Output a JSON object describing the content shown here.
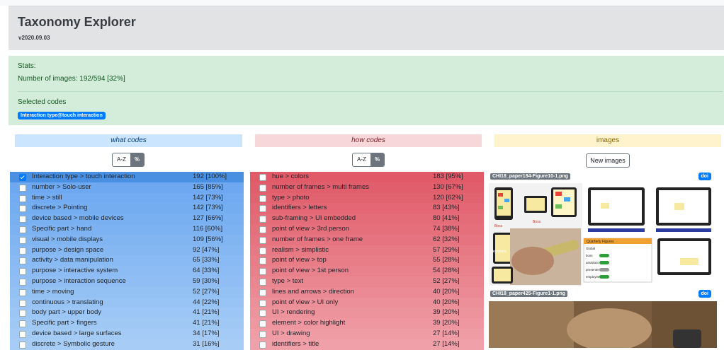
{
  "header": {
    "title": "Taxonomy Explorer",
    "version": "v2020.09.03"
  },
  "stats": {
    "heading": "Stats:",
    "images_line": "Number of images: 192/594 [32%]",
    "selected_heading": "Selected codes",
    "selected_badge": "Interaction type@touch interaction"
  },
  "what": {
    "heading": "what",
    "heading_suffix": " codes",
    "sort_az": "A-Z",
    "sort_pct": "%",
    "items": [
      {
        "label": "Interaction type > touch interaction",
        "count": "192 [100%]",
        "checked": true
      },
      {
        "label": "number > Solo-user",
        "count": "165 [85%]"
      },
      {
        "label": "time > still",
        "count": "142 [73%]"
      },
      {
        "label": "discrete > Pointing",
        "count": "142 [73%]"
      },
      {
        "label": "device based > mobile devices",
        "count": "127 [66%]"
      },
      {
        "label": "Specific part > hand",
        "count": "116 [60%]"
      },
      {
        "label": "visual > mobile displays",
        "count": "109 [56%]"
      },
      {
        "label": "purpose > design space",
        "count": "92 [47%]"
      },
      {
        "label": "activity > data manipulation",
        "count": "65 [33%]"
      },
      {
        "label": "purpose > interactive system",
        "count": "64 [33%]"
      },
      {
        "label": "purpose > interaction sequence",
        "count": "59 [30%]"
      },
      {
        "label": "time > moving",
        "count": "52 [27%]"
      },
      {
        "label": "continuous > translating",
        "count": "44 [22%]"
      },
      {
        "label": "body part > upper body",
        "count": "41 [21%]"
      },
      {
        "label": "Specific part > fingers",
        "count": "41 [21%]"
      },
      {
        "label": "device based > large surfaces",
        "count": "34 [17%]"
      },
      {
        "label": "discrete > Symbolic gesture",
        "count": "31 [16%]"
      }
    ]
  },
  "how": {
    "heading": "how",
    "heading_suffix": " codes",
    "sort_az": "A-Z",
    "sort_pct": "%",
    "items": [
      {
        "label": "hue > colors",
        "count": "183 [95%]"
      },
      {
        "label": "number of frames > multi frames",
        "count": "130 [67%]"
      },
      {
        "label": "type > photo",
        "count": "120 [62%]"
      },
      {
        "label": "identifiers > letters",
        "count": "83 [43%]"
      },
      {
        "label": "sub-framing > UI embedded",
        "count": "80 [41%]"
      },
      {
        "label": "point of view > 3rd person",
        "count": "74 [38%]"
      },
      {
        "label": "number of frames > one frame",
        "count": "62 [32%]"
      },
      {
        "label": "realism > simplistic",
        "count": "57 [29%]"
      },
      {
        "label": "point of view > top",
        "count": "55 [28%]"
      },
      {
        "label": "point of view > 1st person",
        "count": "54 [28%]"
      },
      {
        "label": "type > text",
        "count": "52 [27%]"
      },
      {
        "label": "lines and arrows > direction",
        "count": "40 [20%]"
      },
      {
        "label": "point of view > UI only",
        "count": "40 [20%]"
      },
      {
        "label": "UI > rendering",
        "count": "39 [20%]"
      },
      {
        "label": "element > color highlight",
        "count": "39 [20%]"
      },
      {
        "label": "UI > drawing",
        "count": "27 [14%]"
      },
      {
        "label": "identifiers > title",
        "count": "27 [14%]"
      }
    ]
  },
  "images": {
    "heading": "images",
    "new_button": "New images",
    "cards": [
      {
        "file": "CHI18_paper184-Figure10-1.png",
        "doi": "doi",
        "tile_labels": [
          "Boss",
          "Boss",
          "Assistant",
          "Quarterly Figures",
          "Global",
          "boss",
          "assistant",
          "presenter",
          "employee"
        ]
      },
      {
        "file": "CHI18_paper425-Figure1-1.png",
        "doi": "doi"
      }
    ]
  },
  "colors": {
    "what_header": "#cce5ff",
    "how_header": "#f8d7da",
    "images_header": "#fff3cd",
    "what_selected": "#4a90e2",
    "how_selected": "#e05a68"
  }
}
